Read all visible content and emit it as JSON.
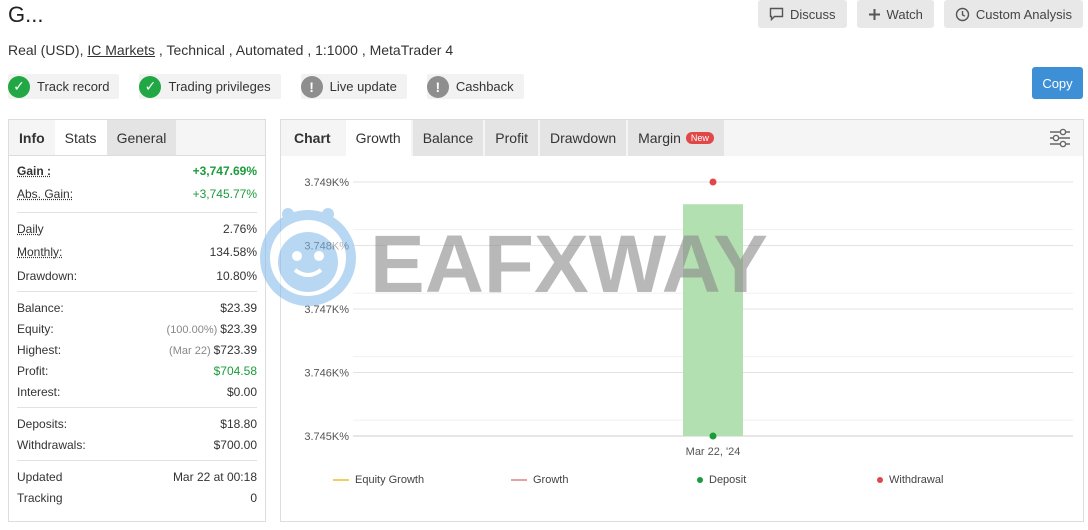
{
  "header": {
    "title": "G...",
    "subtitle_prefix": "Real (USD), ",
    "broker": "IC Markets",
    "subtitle_suffix": " , Technical , Automated , 1:1000 , MetaTrader 4",
    "actions": {
      "discuss": "Discuss",
      "watch": "Watch",
      "custom_analysis": "Custom Analysis"
    },
    "copy": "Copy"
  },
  "badges": [
    {
      "label": "Track record",
      "status": "ok"
    },
    {
      "label": "Trading privileges",
      "status": "ok"
    },
    {
      "label": "Live update",
      "status": "warn"
    },
    {
      "label": "Cashback",
      "status": "warn"
    }
  ],
  "left_tabs": {
    "info": "Info",
    "stats": "Stats",
    "general": "General"
  },
  "stats": {
    "gain_label": "Gain :",
    "gain": "+3,747.69%",
    "abs_gain_label": "Abs. Gain:",
    "abs_gain": "+3,745.77%",
    "daily_label": "Daily",
    "daily": "2.76%",
    "monthly_label": "Monthly:",
    "monthly": "134.58%",
    "drawdown_label": "Drawdown:",
    "drawdown": "10.80%",
    "balance_label": "Balance:",
    "balance": "$23.39",
    "equity_label": "Equity:",
    "equity_pct": "(100.00%)",
    "equity": "$23.39",
    "highest_label": "Highest:",
    "highest_date": "(Mar 22)",
    "highest": "$723.39",
    "profit_label": "Profit:",
    "profit": "$704.58",
    "interest_label": "Interest:",
    "interest": "$0.00",
    "deposits_label": "Deposits:",
    "deposits": "$18.80",
    "withdrawals_label": "Withdrawals:",
    "withdrawals": "$700.00",
    "updated_label": "Updated",
    "updated": "Mar 22 at 00:18",
    "tracking_label": "Tracking",
    "tracking": "0"
  },
  "chart_tabs": {
    "chart": "Chart",
    "growth": "Growth",
    "balance": "Balance",
    "profit": "Profit",
    "drawdown": "Drawdown",
    "margin": "Margin",
    "new": "New"
  },
  "watermark": "EAFXWAY",
  "colors": {
    "bar": "#b3e0b0",
    "deposit": "#1a9c3b",
    "withdrawal": "#e04848",
    "equity_growth": "#f0d060",
    "growth": "#e8a0a0",
    "accent": "#3d8fd6"
  },
  "chart_data": {
    "type": "bar",
    "categories": [
      "Mar 22, '24"
    ],
    "series": [
      {
        "name": "Growth",
        "values": [
          3748.65
        ]
      }
    ],
    "markers": [
      {
        "name": "Deposit",
        "x": "Mar 22, '24",
        "y": 3745.0
      },
      {
        "name": "Withdrawal",
        "x": "Mar 22, '24",
        "y": 3749.0
      }
    ],
    "yticks": [
      "3.749K%",
      "3.748K%",
      "3.747K%",
      "3.746K%",
      "3.745K%"
    ],
    "ytick_values": [
      3749,
      3748,
      3747,
      3746,
      3745
    ],
    "ylim": [
      3745,
      3749
    ],
    "legend": [
      "Equity Growth",
      "Growth",
      "Deposit",
      "Withdrawal"
    ],
    "legend_position": "bottom",
    "grid": true
  }
}
